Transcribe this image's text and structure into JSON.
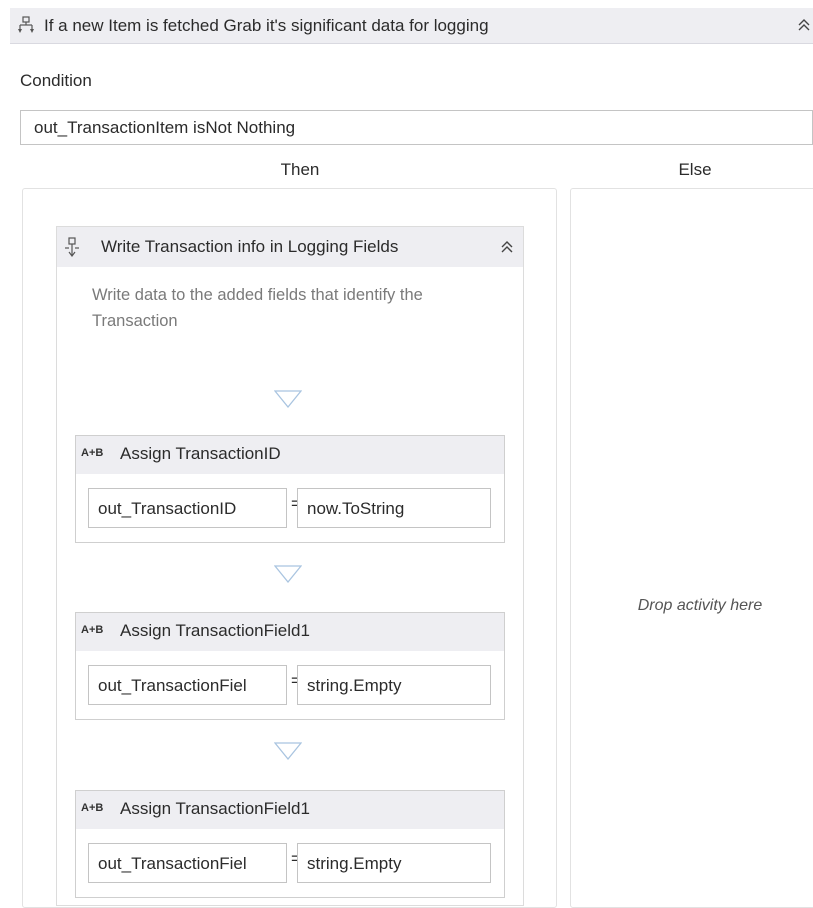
{
  "if_activity": {
    "title": "If a new Item is fetched Grab it's significant data for logging",
    "icon": "if-branch-icon",
    "condition_label": "Condition",
    "condition_value": "out_TransactionItem isNot Nothing",
    "then_label": "Then",
    "else_label": "Else",
    "else_placeholder": "Drop activity here"
  },
  "sequence": {
    "title": "Write Transaction info in Logging Fields",
    "icon": "sequence-icon",
    "annotation": "Write data to the added fields that identify the Transaction"
  },
  "assigns": [
    {
      "icon_label": "A+B",
      "title": "Assign TransactionID",
      "to": "out_TransactionID",
      "eq": "=",
      "value": "now.ToString"
    },
    {
      "icon_label": "A+B",
      "title": "Assign TransactionField1",
      "to": "out_TransactionFiel",
      "eq": "=",
      "value": "string.Empty"
    },
    {
      "icon_label": "A+B",
      "title": "Assign TransactionField1",
      "to": "out_TransactionFiel",
      "eq": "=",
      "value": "string.Empty"
    }
  ],
  "colors": {
    "header_bg": "#eeeef2",
    "border": "#c4c4c4",
    "annotation_text": "#7a7a7a",
    "arrow": "#a9c4e0"
  }
}
